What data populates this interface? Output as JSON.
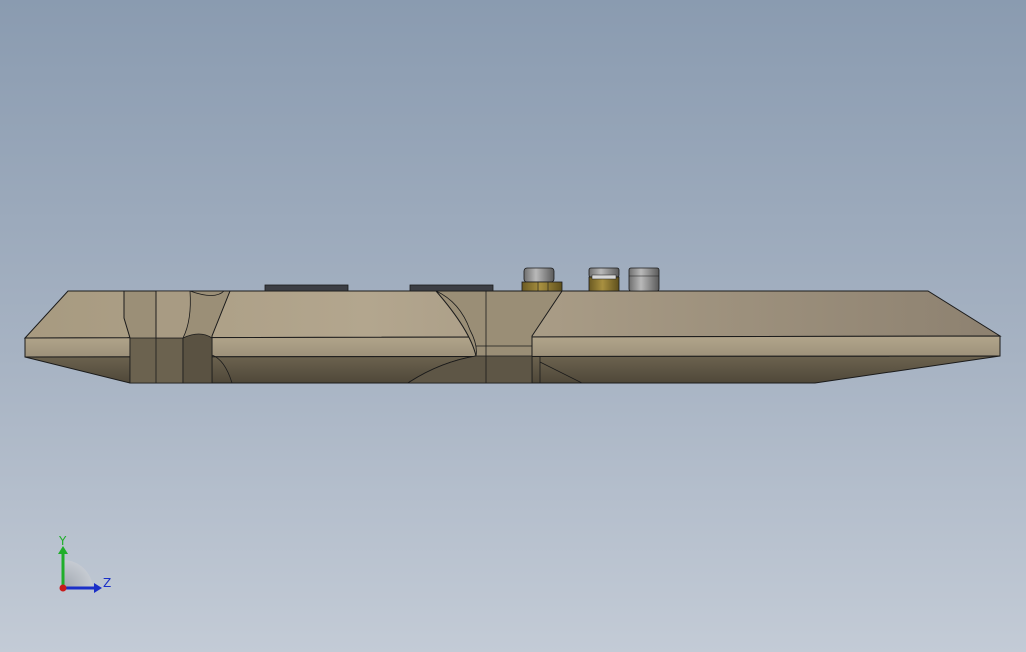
{
  "viewport": {
    "model_name": "",
    "background_top": "#8a9bb0",
    "background_bottom": "#c3cbd6"
  },
  "model": {
    "body_color": "#a99c84",
    "body_dark": "#5f5646",
    "body_mid": "#8b7f69",
    "edge_color": "#1b1b1b",
    "brass_color": "#8a7430",
    "steel_color": "#8d8d8d",
    "pad_color": "#3c3e44"
  },
  "triad": {
    "y_label": "Y",
    "z_label": "Z",
    "y_color": "#1fae2a",
    "z_color": "#1a2fc8",
    "origin_color": "#c81a1a"
  }
}
